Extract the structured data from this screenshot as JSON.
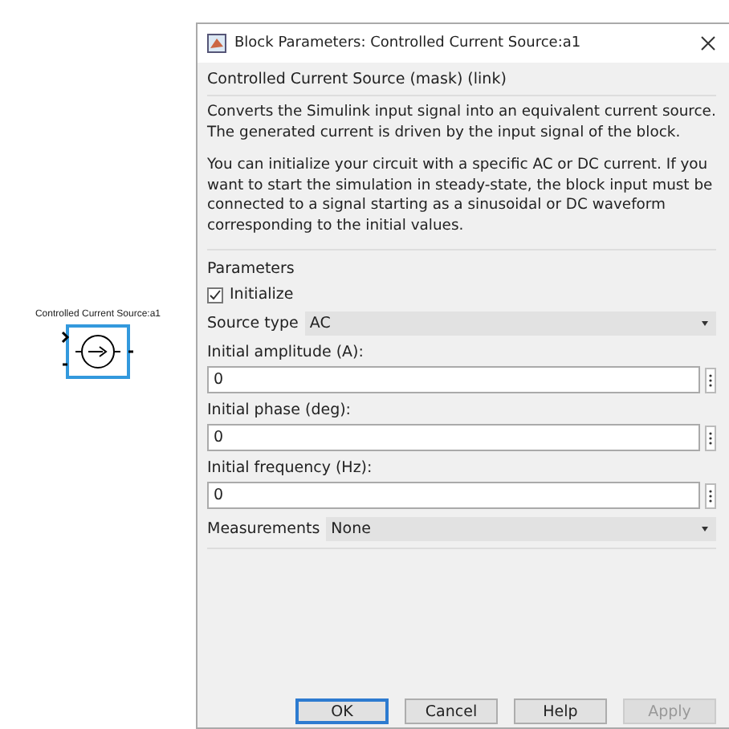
{
  "block": {
    "label": "Controlled Current Source:a1",
    "selected": true
  },
  "dialog": {
    "title": "Block Parameters: Controlled Current Source:a1",
    "heading": "Controlled Current Source (mask) (link)",
    "description": [
      "Converts the Simulink input signal into an equivalent current source. The generated current is driven by the input signal of the block.",
      "You can initialize your circuit with a specific AC or DC current. If you want to start the simulation in steady-state, the block input must be connected to a signal starting as a sinusoidal or DC waveform corresponding to the initial values."
    ],
    "parameters_label": "Parameters",
    "initialize": {
      "label": "Initialize",
      "checked": true
    },
    "source_type": {
      "label": "Source type",
      "value": "AC"
    },
    "fields": [
      {
        "label": "Initial amplitude (A):",
        "value": "0"
      },
      {
        "label": "Initial phase (deg):",
        "value": "0"
      },
      {
        "label": "Initial frequency (Hz):",
        "value": "0"
      }
    ],
    "measurements": {
      "label": "Measurements",
      "value": "None"
    },
    "buttons": [
      {
        "label": "OK",
        "default": true,
        "disabled": false
      },
      {
        "label": "Cancel",
        "default": false,
        "disabled": false
      },
      {
        "label": "Help",
        "default": false,
        "disabled": false
      },
      {
        "label": "Apply",
        "default": false,
        "disabled": true
      }
    ]
  }
}
